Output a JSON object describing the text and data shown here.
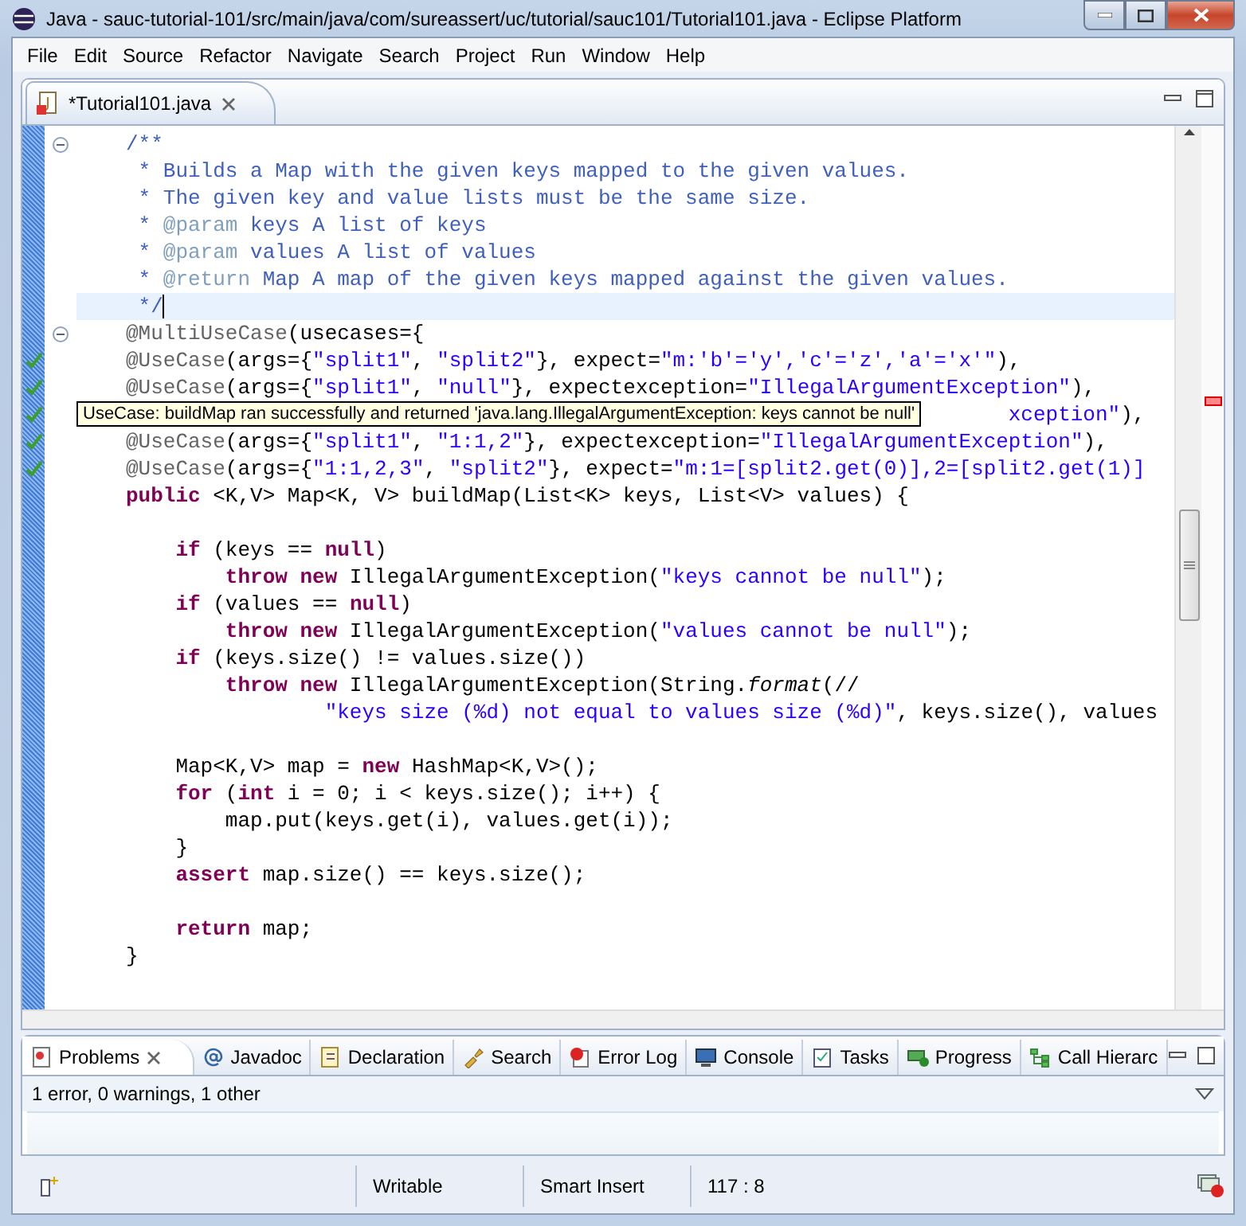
{
  "window": {
    "title": "Java - sauc-tutorial-101/src/main/java/com/sureassert/uc/tutorial/sauc101/Tutorial101.java - Eclipse Platform"
  },
  "menu": [
    "File",
    "Edit",
    "Source",
    "Refactor",
    "Navigate",
    "Search",
    "Project",
    "Run",
    "Window",
    "Help"
  ],
  "editor": {
    "tab": {
      "label": "*Tutorial101.java",
      "selected": true
    },
    "lines": [
      {
        "kind": "code",
        "passed": false,
        "collapsible": true,
        "current": false,
        "space_before": false,
        "tokens": [
          {
            "kind": "comment",
            "text": "/**"
          }
        ]
      },
      {
        "kind": "code",
        "passed": false,
        "collapsible": false,
        "current": false,
        "space_before": false,
        "tokens": [
          {
            "kind": "comment",
            "text": " * Builds a Map with the given keys mapped to the given values."
          }
        ]
      },
      {
        "kind": "code",
        "passed": false,
        "collapsible": false,
        "current": false,
        "space_before": false,
        "tokens": [
          {
            "kind": "comment",
            "text": " * The given key and value lists must be the same size."
          }
        ]
      },
      {
        "kind": "code",
        "passed": false,
        "collapsible": false,
        "current": false,
        "space_before": false,
        "tokens": [
          {
            "kind": "comment",
            "text": " * "
          },
          {
            "kind": "doctag",
            "text": "@param"
          },
          {
            "kind": "comment",
            "text": " keys A list of keys"
          }
        ]
      },
      {
        "kind": "code",
        "passed": false,
        "collapsible": false,
        "current": false,
        "space_before": false,
        "tokens": [
          {
            "kind": "comment",
            "text": " * "
          },
          {
            "kind": "doctag",
            "text": "@param"
          },
          {
            "kind": "comment",
            "text": " values A list of values"
          }
        ]
      },
      {
        "kind": "code",
        "passed": false,
        "collapsible": false,
        "current": false,
        "space_before": false,
        "tokens": [
          {
            "kind": "comment",
            "text": " * "
          },
          {
            "kind": "doctag",
            "text": "@return"
          },
          {
            "kind": "comment",
            "text": " Map A map of the given keys mapped against the given values."
          }
        ]
      },
      {
        "kind": "code",
        "passed": false,
        "collapsible": false,
        "current": true,
        "space_before": false,
        "tokens": [
          {
            "kind": "comment",
            "text": " */"
          }
        ]
      },
      {
        "kind": "code",
        "passed": false,
        "collapsible": true,
        "current": false,
        "space_before": false,
        "tokens": [
          {
            "kind": "annotation",
            "text": "@MultiUseCase"
          },
          {
            "kind": "plain",
            "text": "(usecases={"
          }
        ]
      },
      {
        "kind": "code",
        "passed": true,
        "collapsible": false,
        "current": false,
        "space_before": false,
        "tokens": [
          {
            "kind": "annotation",
            "text": "@UseCase"
          },
          {
            "kind": "plain",
            "text": "(args={"
          },
          {
            "kind": "string",
            "text": "\"split1\""
          },
          {
            "kind": "plain",
            "text": ", "
          },
          {
            "kind": "string",
            "text": "\"split2\""
          },
          {
            "kind": "plain",
            "text": "}, expect="
          },
          {
            "kind": "string",
            "text": "\"m:'b'='y','c'='z','a'='x'\""
          },
          {
            "kind": "plain",
            "text": "),"
          }
        ]
      },
      {
        "kind": "code",
        "passed": true,
        "collapsible": false,
        "current": false,
        "space_before": false,
        "tokens": [
          {
            "kind": "annotation",
            "text": "@UseCase"
          },
          {
            "kind": "plain",
            "text": "(args={"
          },
          {
            "kind": "string",
            "text": "\"split1\""
          },
          {
            "kind": "plain",
            "text": ", "
          },
          {
            "kind": "string",
            "text": "\"null\""
          },
          {
            "kind": "plain",
            "text": "}, expectexception="
          },
          {
            "kind": "string",
            "text": "\"IllegalArgumentException\""
          },
          {
            "kind": "plain",
            "text": "),"
          }
        ]
      },
      {
        "kind": "tooltip",
        "passed": true,
        "collapsible": false,
        "current": false,
        "space_before": false,
        "tooltip": "UseCase: buildMap ran successfully and returned 'java.lang.IllegalArgumentException: keys cannot be null'",
        "tokens": [
          {
            "kind": "string",
            "text": "xception\""
          },
          {
            "kind": "plain",
            "text": "),"
          }
        ]
      },
      {
        "kind": "code",
        "passed": true,
        "collapsible": false,
        "current": false,
        "space_before": false,
        "tokens": [
          {
            "kind": "annotation",
            "text": "@UseCase"
          },
          {
            "kind": "plain",
            "text": "(args={"
          },
          {
            "kind": "string",
            "text": "\"split1\""
          },
          {
            "kind": "plain",
            "text": ", "
          },
          {
            "kind": "string",
            "text": "\"1:1,2\""
          },
          {
            "kind": "plain",
            "text": "}, expectexception="
          },
          {
            "kind": "string",
            "text": "\"IllegalArgumentException\""
          },
          {
            "kind": "plain",
            "text": "),"
          }
        ]
      },
      {
        "kind": "code",
        "passed": true,
        "collapsible": false,
        "current": false,
        "space_before": false,
        "tokens": [
          {
            "kind": "annotation",
            "text": "@UseCase"
          },
          {
            "kind": "plain",
            "text": "(args={"
          },
          {
            "kind": "string",
            "text": "\"1:1,2,3\""
          },
          {
            "kind": "plain",
            "text": ", "
          },
          {
            "kind": "string",
            "text": "\"split2\""
          },
          {
            "kind": "plain",
            "text": "}, expect="
          },
          {
            "kind": "string",
            "text": "\"m:1=[split2.get(0)],2=[split2.get(1)]"
          }
        ]
      },
      {
        "kind": "code",
        "passed": false,
        "collapsible": false,
        "current": false,
        "space_before": false,
        "tokens": [
          {
            "kind": "keyword",
            "text": "public"
          },
          {
            "kind": "plain",
            "text": " <K,V> Map<K, V> buildMap(List<K> keys, List<V> values) {"
          }
        ]
      },
      {
        "kind": "code",
        "passed": false,
        "collapsible": false,
        "current": false,
        "space_before": true,
        "tokens": [
          {
            "kind": "keyword",
            "text": "    if"
          },
          {
            "kind": "plain",
            "text": " (keys == "
          },
          {
            "kind": "keyword",
            "text": "null"
          },
          {
            "kind": "plain",
            "text": ")"
          }
        ]
      },
      {
        "kind": "code",
        "passed": false,
        "collapsible": false,
        "current": false,
        "space_before": false,
        "tokens": [
          {
            "kind": "keyword",
            "text": "        throw new"
          },
          {
            "kind": "plain",
            "text": " IllegalArgumentException("
          },
          {
            "kind": "string",
            "text": "\"keys cannot be null\""
          },
          {
            "kind": "plain",
            "text": ");"
          }
        ]
      },
      {
        "kind": "code",
        "passed": false,
        "collapsible": false,
        "current": false,
        "space_before": false,
        "tokens": [
          {
            "kind": "keyword",
            "text": "    if"
          },
          {
            "kind": "plain",
            "text": " (values == "
          },
          {
            "kind": "keyword",
            "text": "null"
          },
          {
            "kind": "plain",
            "text": ")"
          }
        ]
      },
      {
        "kind": "code",
        "passed": false,
        "collapsible": false,
        "current": false,
        "space_before": false,
        "tokens": [
          {
            "kind": "keyword",
            "text": "        throw new"
          },
          {
            "kind": "plain",
            "text": " IllegalArgumentException("
          },
          {
            "kind": "string",
            "text": "\"values cannot be null\""
          },
          {
            "kind": "plain",
            "text": ");"
          }
        ]
      },
      {
        "kind": "code",
        "passed": false,
        "collapsible": false,
        "current": false,
        "space_before": false,
        "tokens": [
          {
            "kind": "keyword",
            "text": "    if"
          },
          {
            "kind": "plain",
            "text": " (keys.size() != values.size())"
          }
        ]
      },
      {
        "kind": "code",
        "passed": false,
        "collapsible": false,
        "current": false,
        "space_before": false,
        "tokens": [
          {
            "kind": "keyword",
            "text": "        throw new"
          },
          {
            "kind": "plain",
            "text": " IllegalArgumentException(String."
          },
          {
            "kind": "static",
            "text": "format"
          },
          {
            "kind": "plain",
            "text": "(//"
          }
        ]
      },
      {
        "kind": "code",
        "passed": false,
        "collapsible": false,
        "current": false,
        "space_before": false,
        "tokens": [
          {
            "kind": "string",
            "text": "                \"keys size (%d) not equal to values size (%d)\""
          },
          {
            "kind": "plain",
            "text": ", keys.size(), values"
          }
        ]
      },
      {
        "kind": "code",
        "passed": false,
        "collapsible": false,
        "current": false,
        "space_before": true,
        "tokens": [
          {
            "kind": "plain",
            "text": "    Map<K,V> map = "
          },
          {
            "kind": "keyword",
            "text": "new"
          },
          {
            "kind": "plain",
            "text": " HashMap<K,V>();"
          }
        ]
      },
      {
        "kind": "code",
        "passed": false,
        "collapsible": false,
        "current": false,
        "space_before": false,
        "tokens": [
          {
            "kind": "keyword",
            "text": "    for"
          },
          {
            "kind": "plain",
            "text": " ("
          },
          {
            "kind": "keyword",
            "text": "int"
          },
          {
            "kind": "plain",
            "text": " i = 0; i < keys.size(); i++) {"
          }
        ]
      },
      {
        "kind": "code",
        "passed": false,
        "collapsible": false,
        "current": false,
        "space_before": false,
        "tokens": [
          {
            "kind": "plain",
            "text": "        map.put(keys.get(i), values.get(i));"
          }
        ]
      },
      {
        "kind": "code",
        "passed": false,
        "collapsible": false,
        "current": false,
        "space_before": false,
        "tokens": [
          {
            "kind": "plain",
            "text": "    }"
          }
        ]
      },
      {
        "kind": "code",
        "passed": false,
        "collapsible": false,
        "current": false,
        "space_before": false,
        "tokens": [
          {
            "kind": "keyword",
            "text": "    assert"
          },
          {
            "kind": "plain",
            "text": " map.size() == keys.size();"
          }
        ]
      },
      {
        "kind": "code",
        "passed": false,
        "collapsible": false,
        "current": false,
        "space_before": true,
        "tokens": [
          {
            "kind": "keyword",
            "text": "    return"
          },
          {
            "kind": "plain",
            "text": " map;"
          }
        ]
      },
      {
        "kind": "code",
        "passed": false,
        "collapsible": false,
        "current": false,
        "space_before": false,
        "tokens": [
          {
            "kind": "plain",
            "text": "}"
          }
        ]
      }
    ]
  },
  "bottom_panel": {
    "tabs": [
      {
        "label": "Problems",
        "selected": true
      },
      {
        "label": "Javadoc",
        "selected": false
      },
      {
        "label": "Declaration",
        "selected": false
      },
      {
        "label": "Search",
        "selected": false
      },
      {
        "label": "Error Log",
        "selected": false
      },
      {
        "label": "Console",
        "selected": false
      },
      {
        "label": "Tasks",
        "selected": false
      },
      {
        "label": "Progress",
        "selected": false
      },
      {
        "label": "Call Hierarc",
        "selected": false
      }
    ],
    "summary": "1 error, 0 warnings, 1 other"
  },
  "status_bar": [
    "Writable",
    "Smart Insert",
    "117 : 8"
  ]
}
